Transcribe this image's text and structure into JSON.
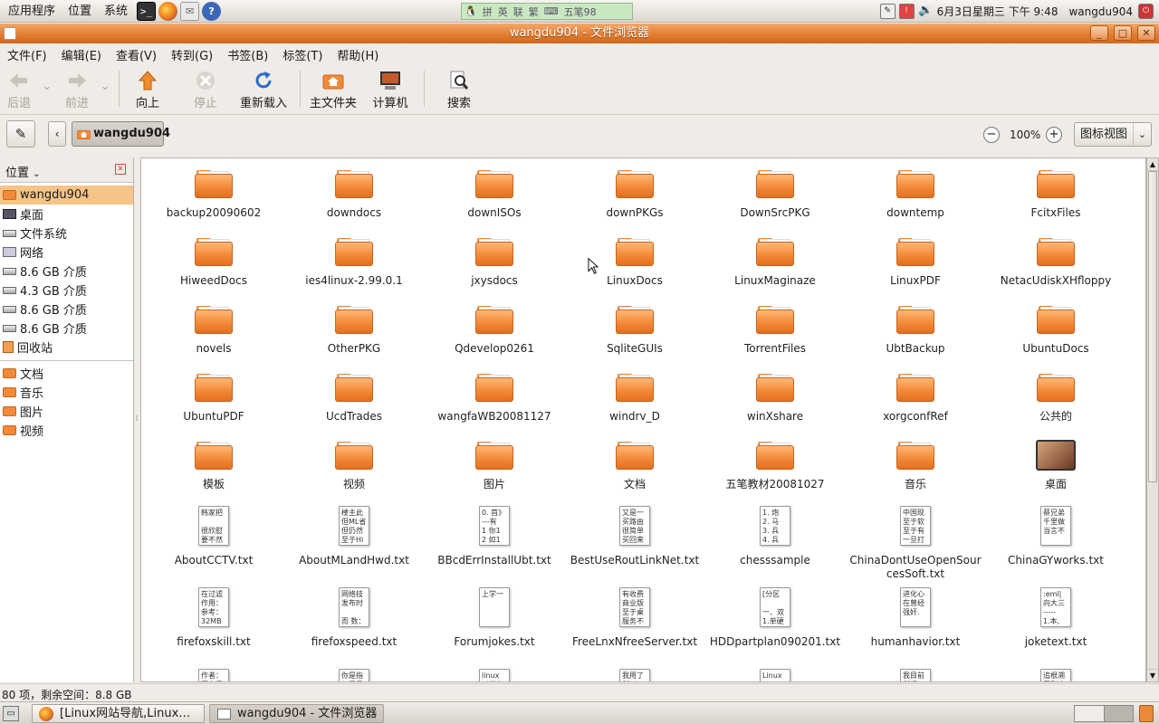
{
  "top_panel": {
    "menus": [
      "应用程序",
      "位置",
      "系统"
    ],
    "launchers": [
      "terminal-icon",
      "firefox-icon",
      "mail-icon",
      "help-icon"
    ],
    "ime": {
      "items": [
        "拼",
        "英",
        "联",
        "繁",
        "五笔98"
      ]
    },
    "clock": "6月3日星期三 下午 9:48",
    "user": "wangdu904"
  },
  "window": {
    "title": "wangdu904 - 文件浏览器",
    "menubar": [
      "文件(F)",
      "编辑(E)",
      "查看(V)",
      "转到(G)",
      "书签(B)",
      "标签(T)",
      "帮助(H)"
    ],
    "toolbar": {
      "back": "后退",
      "forward": "前进",
      "up": "向上",
      "stop": "停止",
      "reload": "重新载入",
      "home": "主文件夹",
      "computer": "计算机",
      "search": "搜索"
    },
    "location": {
      "path_button": "wangdu904",
      "zoom": "100%",
      "view_mode": "图标视图"
    },
    "sidebar": {
      "title": "位置",
      "items": [
        {
          "label": "wangdu904",
          "icon": "home-folder-icon",
          "selected": true
        },
        {
          "label": "桌面",
          "icon": "desktop-icon"
        },
        {
          "label": "文件系统",
          "icon": "drive-icon"
        },
        {
          "label": "网络",
          "icon": "network-icon"
        },
        {
          "label": "8.6 GB 介质",
          "icon": "drive-icon"
        },
        {
          "label": "4.3 GB 介质",
          "icon": "drive-icon"
        },
        {
          "label": "8.6 GB 介质",
          "icon": "drive-icon"
        },
        {
          "label": "8.6 GB 介质",
          "icon": "drive-icon"
        },
        {
          "label": "回收站",
          "icon": "trash-icon"
        }
      ],
      "bookmarks": [
        {
          "label": "文档",
          "icon": "folder-icon"
        },
        {
          "label": "音乐",
          "icon": "folder-icon"
        },
        {
          "label": "图片",
          "icon": "folder-icon"
        },
        {
          "label": "视频",
          "icon": "folder-icon"
        }
      ]
    },
    "files": [
      {
        "name": "backup20090602",
        "type": "folder"
      },
      {
        "name": "downdocs",
        "type": "folder"
      },
      {
        "name": "downISOs",
        "type": "folder"
      },
      {
        "name": "downPKGs",
        "type": "folder"
      },
      {
        "name": "DownSrcPKG",
        "type": "folder"
      },
      {
        "name": "downtemp",
        "type": "folder"
      },
      {
        "name": "FcitxFiles",
        "type": "folder"
      },
      {
        "name": "HiweedDocs",
        "type": "folder"
      },
      {
        "name": "ies4linux-2.99.0.1",
        "type": "folder"
      },
      {
        "name": "jxysdocs",
        "type": "folder"
      },
      {
        "name": "LinuxDocs",
        "type": "folder"
      },
      {
        "name": "LinuxMaginaze",
        "type": "folder"
      },
      {
        "name": "LinuxPDF",
        "type": "folder"
      },
      {
        "name": "NetacUdiskXHfloppy",
        "type": "folder"
      },
      {
        "name": "novels",
        "type": "folder"
      },
      {
        "name": "OtherPKG",
        "type": "folder"
      },
      {
        "name": "Qdevelop0261",
        "type": "folder"
      },
      {
        "name": "SqliteGUIs",
        "type": "folder"
      },
      {
        "name": "TorrentFiles",
        "type": "folder"
      },
      {
        "name": "UbtBackup",
        "type": "folder"
      },
      {
        "name": "UbuntuDocs",
        "type": "folder"
      },
      {
        "name": "UbuntuPDF",
        "type": "folder"
      },
      {
        "name": "UcdTrades",
        "type": "folder"
      },
      {
        "name": "wangfaWB20081127",
        "type": "folder"
      },
      {
        "name": "windrv_D",
        "type": "folder"
      },
      {
        "name": "winXshare",
        "type": "folder"
      },
      {
        "name": "xorgconfRef",
        "type": "folder"
      },
      {
        "name": "公共的",
        "type": "folder"
      },
      {
        "name": "模板",
        "type": "folder"
      },
      {
        "name": "视频",
        "type": "folder"
      },
      {
        "name": "图片",
        "type": "folder"
      },
      {
        "name": "文档",
        "type": "folder"
      },
      {
        "name": "五笔教材20081027",
        "type": "folder"
      },
      {
        "name": "音乐",
        "type": "folder"
      },
      {
        "name": "桌面",
        "type": "desktop"
      },
      {
        "name": "AboutCCTV.txt",
        "type": "text",
        "preview": "韩家把\n\n很欣慰\n要不然"
      },
      {
        "name": "AboutMLandHwd.txt",
        "type": "text",
        "preview": "楼主此\n但ML省\n但仍然\n至于Hi"
      },
      {
        "name": "BBcdErrInstallUbt.txt",
        "type": "text",
        "preview": "0. 首》\n---有\n1 你1\n2 如1"
      },
      {
        "name": "BestUseRoutLinkNet.txt",
        "type": "text",
        "preview": "又是一\n买路由\n很简单\n买回来"
      },
      {
        "name": "chesssample",
        "type": "text",
        "preview": "1. 炮\n2. 马\n3. 兵\n4. 兵"
      },
      {
        "name": "ChinaDontUseOpenSourcesSoft.txt",
        "type": "text",
        "preview": "中国现\n至于软\n至于有\n一旦打"
      },
      {
        "name": "ChinaGYworks.txt",
        "type": "text",
        "preview": "蔡兄弟\n千里做\n当言不"
      },
      {
        "name": "firefoxskill.txt",
        "type": "text",
        "preview": "在过滤\n作用：\n参考：\n32MB"
      },
      {
        "name": "firefoxspeed.txt",
        "type": "text",
        "preview": "网络技\n发布时\n\n而 数："
      },
      {
        "name": "Forumjokes.txt",
        "type": "text",
        "preview": "上学一"
      },
      {
        "name": "FreeLnxNfreeServer.txt",
        "type": "text",
        "preview": "有收费\n商业版\n至于桌\n服务不"
      },
      {
        "name": "HDDpartplan090201.txt",
        "type": "text",
        "preview": "[分区\n\n一、双\n1.单硬"
      },
      {
        "name": "humanhavior.txt",
        "type": "text",
        "preview": "进化心\n在曾经\n强奸."
      },
      {
        "name": "joketext.txt",
        "type": "text",
        "preview": ":eml|\n向大三\n-----\n1.本,"
      },
      {
        "name": "",
        "type": "text",
        "preview": "作者：\n医力日"
      },
      {
        "name": "",
        "type": "text",
        "preview": "你是指\n如果是"
      },
      {
        "name": "",
        "type": "text",
        "preview": "linux\n以前有"
      },
      {
        "name": "",
        "type": "text",
        "preview": "我用了\n所以"
      },
      {
        "name": "",
        "type": "text",
        "preview": "Linux\nLinux"
      },
      {
        "name": "",
        "type": "text",
        "preview": "我目前\n所谓"
      },
      {
        "name": "",
        "type": "text",
        "preview": "追根溯\n看到这"
      }
    ],
    "status": "80 项，剩余空间：8.8 GB"
  },
  "taskbar": {
    "tasks": [
      {
        "label": "[Linux网站导航,Linux…",
        "icon": "firefox-icon",
        "active": false
      },
      {
        "label": "wangdu904 - 文件浏览器",
        "icon": "file-browser-icon",
        "active": true
      }
    ]
  },
  "colors": {
    "accent": "#e07a2c",
    "folder": "#f28a38",
    "selection": "#f5c486"
  }
}
